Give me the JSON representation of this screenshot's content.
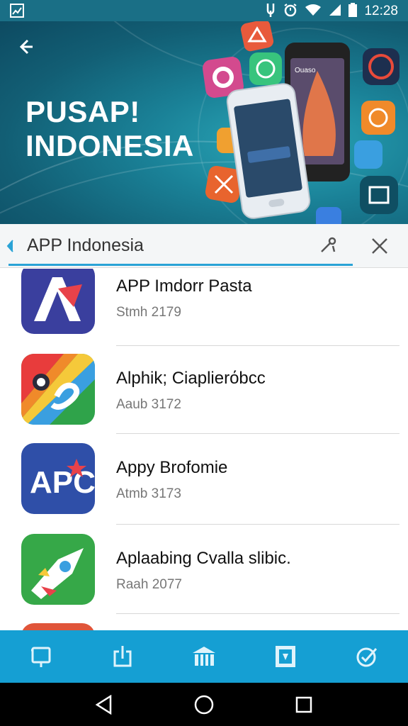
{
  "status_bar": {
    "time": "12:28",
    "icons": [
      "image-notification-icon",
      "usb-icon",
      "alarm-icon",
      "wifi-icon",
      "signal-icon",
      "battery-icon"
    ]
  },
  "hero": {
    "title": "PUSAP!\nINDONESIA",
    "back_icon": "back-arrow-icon",
    "phone_screen_text": "Ouaso"
  },
  "search": {
    "value": "APP Indonesia",
    "placeholder": "APP Indonesia",
    "voice_icon": "voice-search-icon",
    "clear_icon": "close-icon",
    "accent_color": "#2aa3d6"
  },
  "results": [
    {
      "name": "APP Imdorr Pasta",
      "meta": "Stmh 2179",
      "icon": "app-a-icon"
    },
    {
      "name": "Alphik; Ciaplierόbcc",
      "meta": "Aaub 3172",
      "icon": "app-rainbow-icon"
    },
    {
      "name": "Appy Brofomie",
      "meta": "Atmb 3173",
      "icon": "app-apc-icon"
    },
    {
      "name": "Aplaabing Cvalla slibic.",
      "meta": "Raah 2077",
      "icon": "app-rocket-icon"
    }
  ],
  "bottom_nav": {
    "items": [
      {
        "name": "tab-featured",
        "icon": "device-icon"
      },
      {
        "name": "tab-updates",
        "icon": "download-icon"
      },
      {
        "name": "tab-categories",
        "icon": "building-icon"
      },
      {
        "name": "tab-library",
        "icon": "store-icon"
      },
      {
        "name": "tab-settings",
        "icon": "check-circle-icon"
      }
    ],
    "color": "#159fd3"
  },
  "system_nav": {
    "back_icon": "triangle-back-icon",
    "home_icon": "circle-home-icon",
    "recents_icon": "square-recents-icon"
  }
}
